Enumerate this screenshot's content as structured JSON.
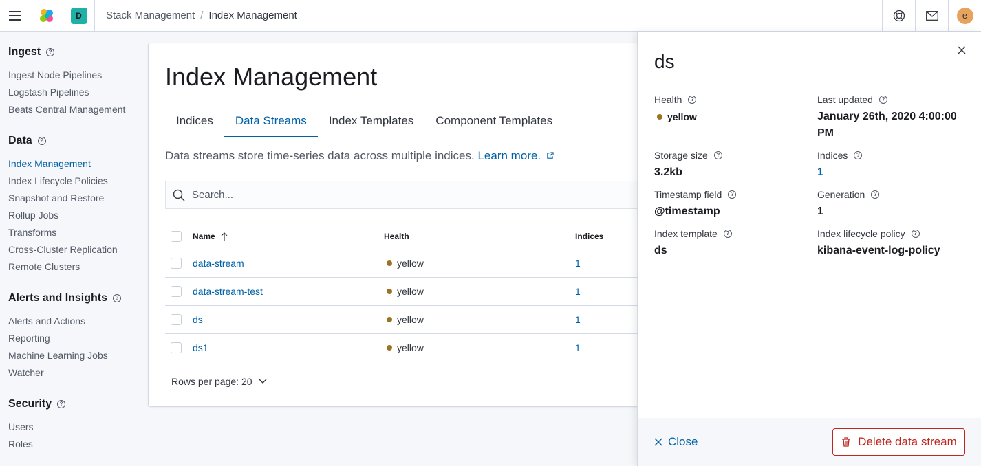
{
  "header": {
    "space_initial": "D",
    "breadcrumbs": [
      "Stack Management",
      "Index Management"
    ],
    "user_initial": "e"
  },
  "sidebar": {
    "groups": [
      {
        "title": "Ingest",
        "items": [
          "Ingest Node Pipelines",
          "Logstash Pipelines",
          "Beats Central Management"
        ]
      },
      {
        "title": "Data",
        "items": [
          "Index Management",
          "Index Lifecycle Policies",
          "Snapshot and Restore",
          "Rollup Jobs",
          "Transforms",
          "Cross-Cluster Replication",
          "Remote Clusters"
        ]
      },
      {
        "title": "Alerts and Insights",
        "items": [
          "Alerts and Actions",
          "Reporting",
          "Machine Learning Jobs",
          "Watcher"
        ]
      },
      {
        "title": "Security",
        "items": [
          "Users",
          "Roles"
        ]
      }
    ],
    "active_item": "Index Management"
  },
  "main": {
    "title": "Index Management",
    "tabs": [
      {
        "label": "Indices",
        "active": false
      },
      {
        "label": "Data Streams",
        "active": true
      },
      {
        "label": "Index Templates",
        "active": false
      },
      {
        "label": "Component Templates",
        "active": false
      }
    ],
    "description": "Data streams store time-series data across multiple indices.",
    "learn_more": "Learn more.",
    "search_placeholder": "Search...",
    "table": {
      "columns": [
        "Name",
        "Health",
        "Indices"
      ],
      "rows": [
        {
          "name": "data-stream",
          "health": "yellow",
          "indices": "1"
        },
        {
          "name": "data-stream-test",
          "health": "yellow",
          "indices": "1"
        },
        {
          "name": "ds",
          "health": "yellow",
          "indices": "1"
        },
        {
          "name": "ds1",
          "health": "yellow",
          "indices": "1"
        }
      ]
    },
    "rows_per_page": "Rows per page: 20"
  },
  "flyout": {
    "title": "ds",
    "fields": {
      "health_label": "Health",
      "health_value": "yellow",
      "last_updated_label": "Last updated",
      "last_updated_value": "January 26th, 2020 4:00:00 PM",
      "storage_label": "Storage size",
      "storage_value": "3.2kb",
      "indices_label": "Indices",
      "indices_value": "1",
      "timestamp_label": "Timestamp field",
      "timestamp_value": "@timestamp",
      "generation_label": "Generation",
      "generation_value": "1",
      "template_label": "Index template",
      "template_value": "ds",
      "policy_label": "Index lifecycle policy",
      "policy_value": "kibana-event-log-policy"
    },
    "close_label": "Close",
    "delete_label": "Delete data stream"
  },
  "colors": {
    "accent": "#0061a6",
    "health_yellow": "#9c7325",
    "danger": "#bd271e",
    "space_badge": "#1fb0a6",
    "avatar": "#e7a35c"
  }
}
